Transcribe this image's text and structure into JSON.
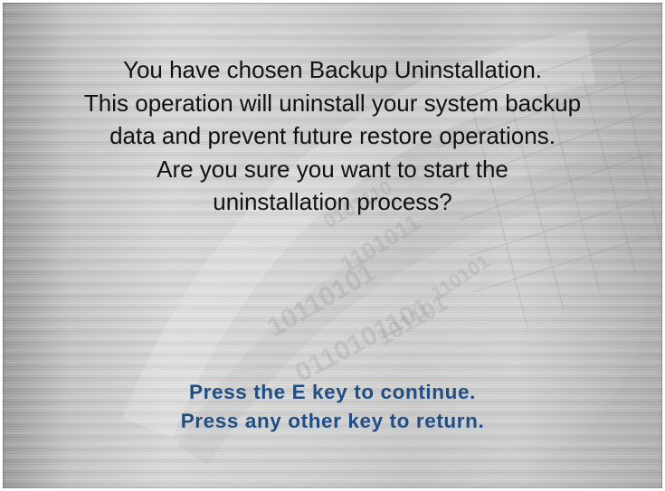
{
  "dialog": {
    "message_lines": [
      "You have chosen Backup Uninstallation.",
      "This operation will uninstall your system backup",
      "data and prevent future restore operations.",
      "Are you sure you want to start the",
      "uninstallation process?"
    ],
    "prompts": [
      "Press the E key to continue.",
      "Press any other key to return."
    ]
  },
  "colors": {
    "background_metal": "#cfcfcf",
    "message_text": "#111111",
    "prompt_text": "#1f4e85"
  },
  "icons": {
    "background_decoration": "binary-digits-globe-watermark"
  }
}
